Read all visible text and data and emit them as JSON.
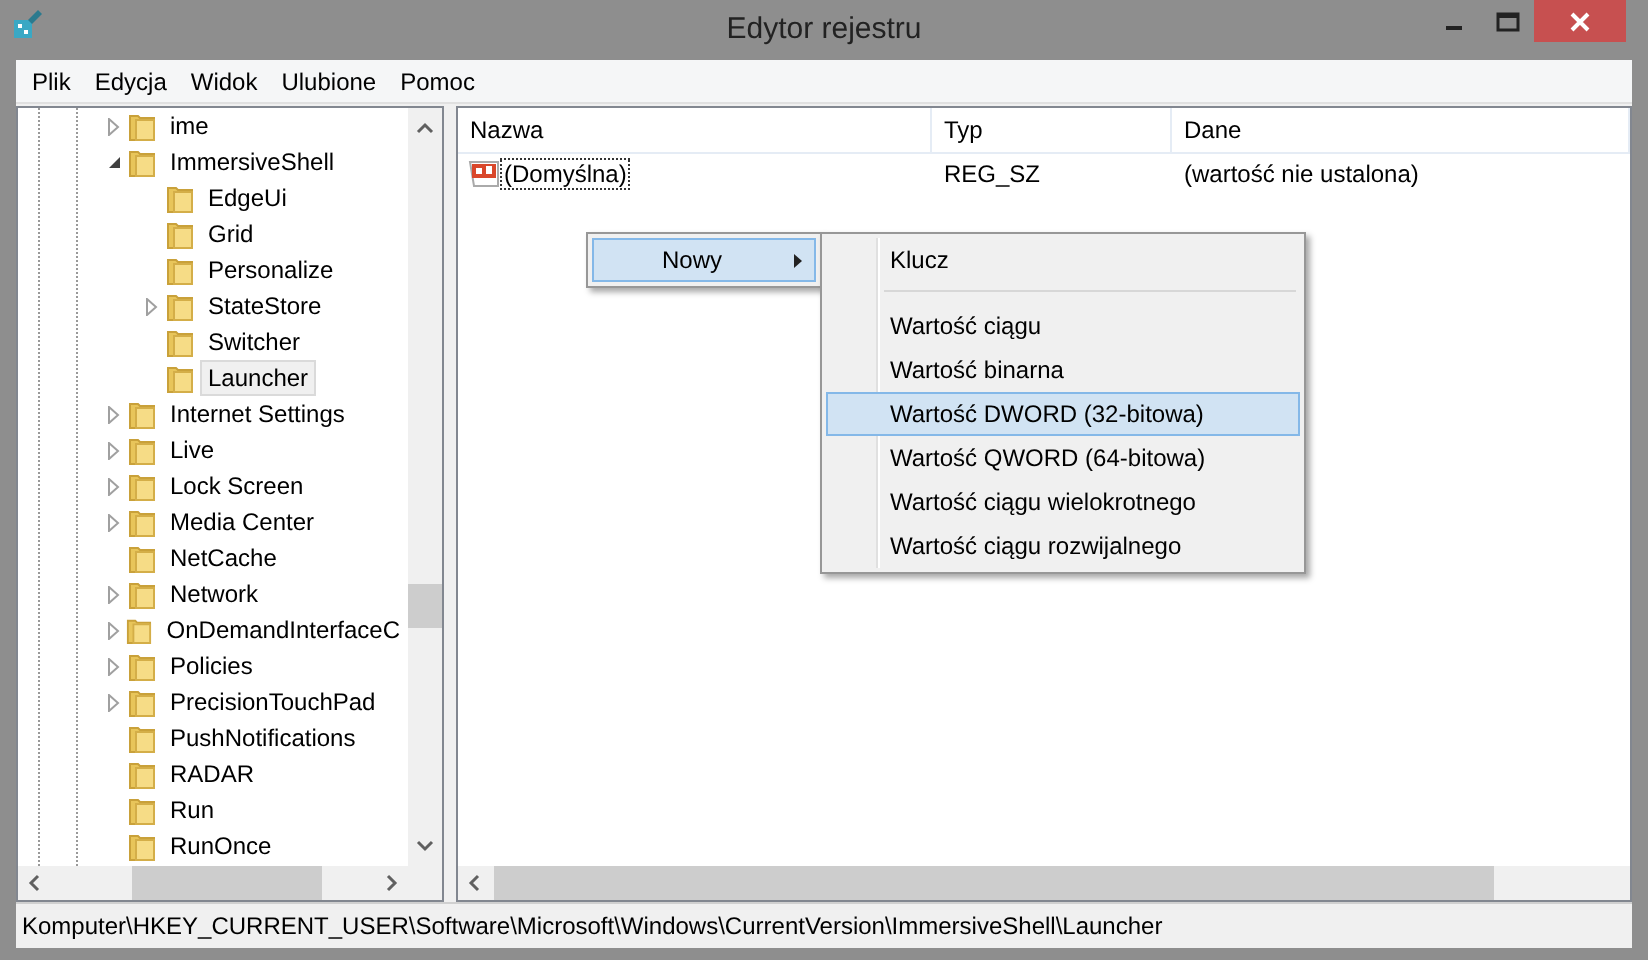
{
  "window": {
    "title": "Edytor rejestru"
  },
  "menu_bar": [
    "Plik",
    "Edycja",
    "Widok",
    "Ulubione",
    "Pomoc"
  ],
  "tree": [
    {
      "label": "ime",
      "expanded": false,
      "selected": false
    },
    {
      "label": "ImmersiveShell",
      "expanded": true,
      "selected": false,
      "children": [
        {
          "label": "EdgeUi",
          "selected": false
        },
        {
          "label": "Grid",
          "selected": false
        },
        {
          "label": "Personalize",
          "selected": false
        },
        {
          "label": "StateStore",
          "expanded": false,
          "selected": false
        },
        {
          "label": "Switcher",
          "selected": false
        },
        {
          "label": "Launcher",
          "selected": true
        }
      ]
    },
    {
      "label": "Internet Settings",
      "expanded": false,
      "selected": false
    },
    {
      "label": "Live",
      "expanded": false,
      "selected": false
    },
    {
      "label": "Lock Screen",
      "expanded": false,
      "selected": false
    },
    {
      "label": "Media Center",
      "expanded": false,
      "selected": false
    },
    {
      "label": "NetCache",
      "selected": false
    },
    {
      "label": "Network",
      "expanded": false,
      "selected": false
    },
    {
      "label": "OnDemandInterfaceC",
      "expanded": false,
      "selected": false
    },
    {
      "label": "Policies",
      "expanded": false,
      "selected": false
    },
    {
      "label": "PrecisionTouchPad",
      "expanded": false,
      "selected": false
    },
    {
      "label": "PushNotifications",
      "selected": false
    },
    {
      "label": "RADAR",
      "selected": false
    },
    {
      "label": "Run",
      "selected": false
    },
    {
      "label": "RunOnce",
      "selected": false
    }
  ],
  "list": {
    "columns": [
      "Nazwa",
      "Typ",
      "Dane"
    ],
    "rows": [
      {
        "name": "(Domyślna)",
        "type": "REG_SZ",
        "data": "(wartość nie ustalona)",
        "focused": true
      }
    ]
  },
  "context_menu": {
    "items": [
      {
        "label": "Nowy",
        "selected": true,
        "submenu": true
      }
    ]
  },
  "submenu": {
    "items": [
      {
        "kind": "item",
        "label": "Klucz",
        "selected": false
      },
      {
        "kind": "separator"
      },
      {
        "kind": "item",
        "label": "Wartość ciągu",
        "selected": false
      },
      {
        "kind": "item",
        "label": "Wartość binarna",
        "selected": false
      },
      {
        "kind": "item",
        "label": "Wartość DWORD (32-bitowa)",
        "selected": true
      },
      {
        "kind": "item",
        "label": "Wartość QWORD (64-bitowa)",
        "selected": false
      },
      {
        "kind": "item",
        "label": "Wartość ciągu wielokrotnego",
        "selected": false
      },
      {
        "kind": "item",
        "label": "Wartość ciągu rozwijalnego",
        "selected": false
      }
    ]
  },
  "status_bar": "Komputer\\HKEY_CURRENT_USER\\Software\\Microsoft\\Windows\\CurrentVersion\\ImmersiveShell\\Launcher"
}
